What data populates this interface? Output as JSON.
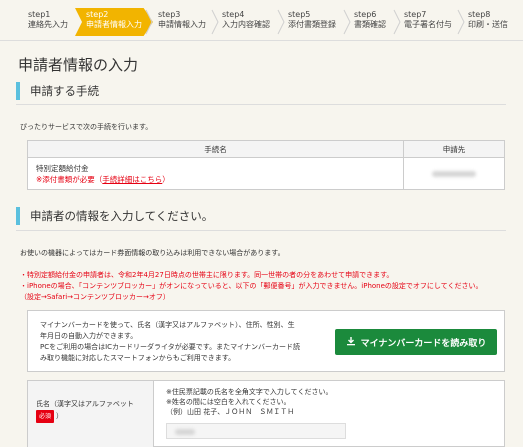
{
  "stepper": [
    {
      "num": "step1",
      "label": "連絡先入力"
    },
    {
      "num": "step2",
      "label": "申請者情報入力"
    },
    {
      "num": "step3",
      "label": "申請情報入力"
    },
    {
      "num": "step4",
      "label": "入力内容確認"
    },
    {
      "num": "step5",
      "label": "添付書類登録"
    },
    {
      "num": "step6",
      "label": "書類確認"
    },
    {
      "num": "step7",
      "label": "電子署名付与"
    },
    {
      "num": "step8",
      "label": "印刷・送信"
    }
  ],
  "page_title": "申請者情報の入力",
  "section1": {
    "heading": "申請する手続",
    "intro": "ぴったりサービスで次の手続を行います。",
    "table": {
      "col1": "手続名",
      "col2": "申請先",
      "row_name": "特別定額給付金",
      "attach_note": "※添付書類が必要（",
      "attach_link": "手続詳細はこちら",
      "attach_close": "）"
    }
  },
  "section2": {
    "heading": "申請者の情報を入力してください。",
    "note": "お使いの機器によってはカード券面情報の取り込みは利用できない場合があります。",
    "warn1": "・特別定額給付金の申請者は、令和2年4月27日時点の世帯主に限ります。同一世帯の者の分をあわせて申請できます。",
    "warn2": "・iPhoneの場合、「コンテンツブロッカー」がオンになっていると、以下の「郵便番号」が入力できません。iPhoneの設定でオフにしてください。",
    "warn3": "（設定→Safari→コンテンツブロッカー→オフ）"
  },
  "card_box": {
    "line1": "マイナンバーカードを使って、氏名（漢字又はアルファベット）、住所、性別、生",
    "line2": "年月日の自動入力ができます。",
    "line3": "PCをご利用の場合はICカードリーダライタが必要です。またマイナンバーカード読",
    "line4": "み取り機能に対応したスマートフォンからもご利用できます。",
    "button": "マイナンバーカードを読み取り"
  },
  "name_field": {
    "label": "氏名（漢字又はアルファベット",
    "required": "必須",
    "label_close": "）",
    "help1": "※住民票記載の氏名を全角文字で入力してください。",
    "help2": "※姓名の間には空白を入れてください。",
    "help3": "（例）山田 花子、ＪＯＨＮ　ＳＭＩＴＨ"
  },
  "colors": {
    "active_step": "#f2b400",
    "accent_bar": "#5bc0de",
    "button_green": "#1b8a3c",
    "warning_red": "#e60012"
  }
}
